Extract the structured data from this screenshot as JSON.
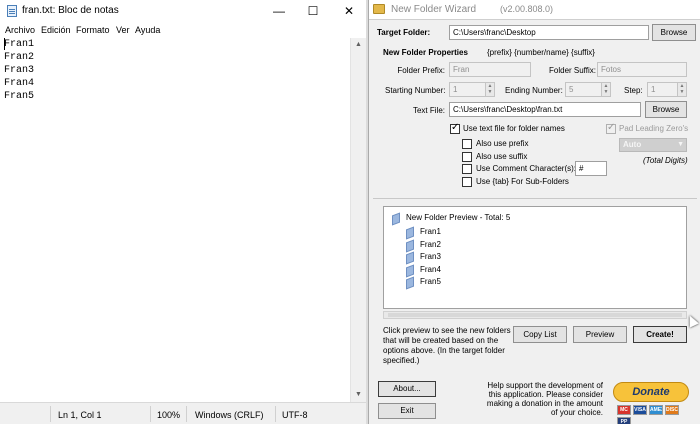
{
  "notepad": {
    "title": "fran.txt: Bloc de notas",
    "controls": {
      "minimize": "—",
      "maximize": "☐",
      "close": "✕"
    },
    "menu": [
      "Archivo",
      "Edición",
      "Formato",
      "Ver",
      "Ayuda"
    ],
    "lines": [
      "Fran1",
      "Fran2",
      "Fran3",
      "Fran4",
      "Fran5"
    ],
    "status": {
      "position": "Ln 1, Col 1",
      "zoom": "100%",
      "line_endings": "Windows (CRLF)",
      "encoding": "UTF-8"
    }
  },
  "wizard": {
    "title": "New Folder Wizard",
    "version": "(v2.00.808.0)",
    "target_folder_label": "Target Folder:",
    "target_folder_value": "C:\\Users\\franc\\Desktop",
    "browse_label": "Browse",
    "properties_label": "New Folder Properties",
    "format_hint": "{prefix} {number/name} {suffix}",
    "prefix_label": "Folder Prefix:",
    "prefix_value": "Fran",
    "suffix_label": "Folder Suffix:",
    "suffix_value": "Fotos",
    "start_label": "Starting Number:",
    "start_value": "1",
    "end_label": "Ending Number:",
    "end_value": "5",
    "step_label": "Step:",
    "step_value": "1",
    "textfile_label": "Text File:",
    "textfile_value": "C:\\Users\\franc\\Desktop\\fran.txt",
    "browse2_label": "Browse",
    "use_text_file": {
      "label": "Use text file for folder names",
      "checked": true
    },
    "pad_zeros": {
      "label": "Pad Leading Zero's",
      "checked": true
    },
    "also_prefix": {
      "label": "Also use prefix",
      "checked": false
    },
    "also_suffix": {
      "label": "Also use suffix",
      "checked": false
    },
    "comment_char": {
      "label": "Use Comment Character(s):",
      "checked": false,
      "value": "#"
    },
    "tab_subfolders": {
      "label": "Use {tab} For Sub-Folders",
      "checked": false
    },
    "auto_label": "Auto",
    "total_digits_label": "(Total Digits)",
    "preview": {
      "root": "New Folder Preview - Total: 5",
      "items": [
        "Fran1",
        "Fran2",
        "Fran3",
        "Fran4",
        "Fran5"
      ]
    },
    "info_text": "Click preview to see the new folders that will be created based on the options above. (In the target folder specified.)",
    "copy_list_label": "Copy List",
    "preview_label": "Preview",
    "create_label": "Create!",
    "about_label": "About...",
    "exit_label": "Exit",
    "support_text": "Help support the development of this application. Please consider making a donation in the amount of your choice.",
    "donate_label": "Donate",
    "card_labels": [
      "MC",
      "VISA",
      "AMEX",
      "DISC",
      "PP"
    ],
    "colors": {
      "donate": "#f7c23a",
      "donate_text": "#1e3a6e"
    }
  }
}
